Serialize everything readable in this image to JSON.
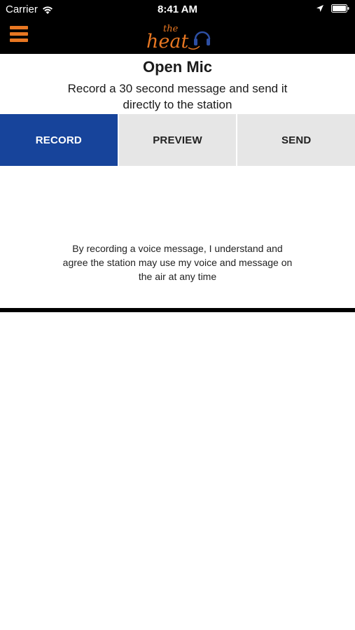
{
  "status_bar": {
    "carrier": "Carrier",
    "time": "8:41 AM",
    "wifi_icon": "wifi-icon",
    "location_icon": "location-arrow-icon",
    "battery_icon": "battery-icon"
  },
  "nav": {
    "menu_icon": "hamburger-menu-icon",
    "logo_text_top": "the",
    "logo_text_main": "heat",
    "colors": {
      "accent": "#e87722",
      "headphones": "#2d4fa3"
    }
  },
  "page": {
    "title": "Open Mic",
    "subtitle": "Record a 30 second message and send it directly to the station"
  },
  "tabs": [
    {
      "label": "RECORD",
      "active": true
    },
    {
      "label": "PREVIEW",
      "active": false
    },
    {
      "label": "SEND",
      "active": false
    }
  ],
  "content": {
    "disclaimer": "By recording a voice message, I understand and agree the station may use my voice and message on the air at any time"
  },
  "colors": {
    "active_tab": "#17449b",
    "inactive_tab": "#e6e6e6",
    "header_bg": "#000000"
  }
}
